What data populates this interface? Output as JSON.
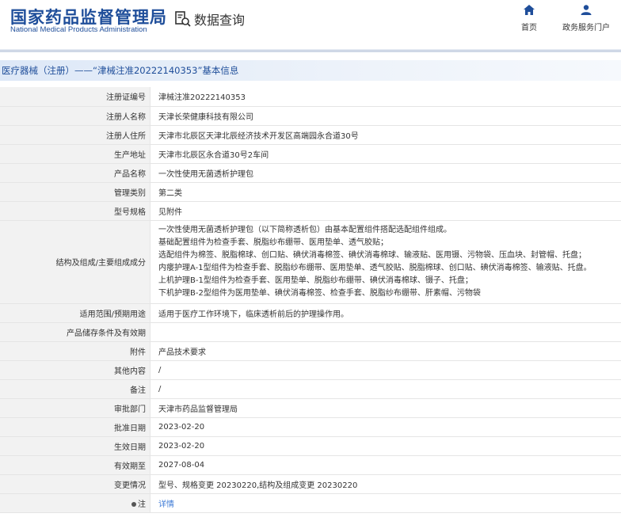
{
  "header": {
    "logo_cn": "国家药品监督管理局",
    "logo_en": "National Medical Products Administration",
    "data_query": "数据查询",
    "nav_home": "首页",
    "nav_portal": "政务服务门户"
  },
  "title": "医疗器械（注册）——“津械注准20222140353”基本信息",
  "fields": [
    {
      "label": "注册证编号",
      "value": "津械注准20222140353"
    },
    {
      "label": "注册人名称",
      "value": "天津长荣健康科技有限公司"
    },
    {
      "label": "注册人住所",
      "value": "天津市北辰区天津北辰经济技术开发区高端园永合道30号"
    },
    {
      "label": "生产地址",
      "value": "天津市北辰区永合道30号2车间"
    },
    {
      "label": "产品名称",
      "value": "一次性使用无菌透析护理包"
    },
    {
      "label": "管理类别",
      "value": "第二类"
    },
    {
      "label": "型号规格",
      "value": "见附件"
    }
  ],
  "structure": {
    "label": "结构及组成/主要组成成分",
    "lines": [
      "一次性使用无菌透析护理包（以下简称透析包）由基本配置组件搭配选配组件组成。",
      "基础配置组件为检查手套、脱脂纱布绷带、医用垫单、透气胶贴；",
      "选配组件为棉签、脱脂棉球、创口贴、碘伏消毒棉签、碘伏消毒棉球、输液贴、医用镊、污物袋、压血块、封管帽、托盘；",
      "内瘘护理A-1型组件为检查手套、脱脂纱布绷带、医用垫单、透气胶贴、脱脂棉球、创口贴、碘伏消毒棉签、输液贴、托盘。",
      "上机护理B-1型组件为检查手套、医用垫单、脱脂纱布绷带、碘伏消毒棉球、镊子、托盘；",
      "下机护理B-2型组件为医用垫单、碘伏消毒棉签、检查手套、脱脂纱布绷带、肝素帽、污物袋"
    ]
  },
  "fields2": [
    {
      "label": "适用范围/预期用途",
      "value": "适用于医疗工作环境下，临床透析前后的护理操作用。"
    },
    {
      "label": "产品储存条件及有效期",
      "value": ""
    },
    {
      "label": "附件",
      "value": "产品技术要求"
    },
    {
      "label": "其他内容",
      "value": "/"
    },
    {
      "label": "备注",
      "value": "/"
    },
    {
      "label": "审批部门",
      "value": "天津市药品监督管理局"
    },
    {
      "label": "批准日期",
      "value": "2023-02-20"
    },
    {
      "label": "生效日期",
      "value": "2023-02-20"
    },
    {
      "label": "有效期至",
      "value": "2027-08-04"
    },
    {
      "label": "变更情况",
      "value": "型号、规格变更 20230220,结构及组成变更 20230220"
    }
  ],
  "note": {
    "label": "注",
    "value": "详情"
  },
  "colors": {
    "brand": "#1f4e9a",
    "link": "#3f7bd6",
    "label_bg": "#f2f2f2"
  },
  "icons": {
    "data_query": "document-search-icon",
    "home": "home-icon",
    "portal": "user-icon",
    "note": "dot-icon"
  }
}
